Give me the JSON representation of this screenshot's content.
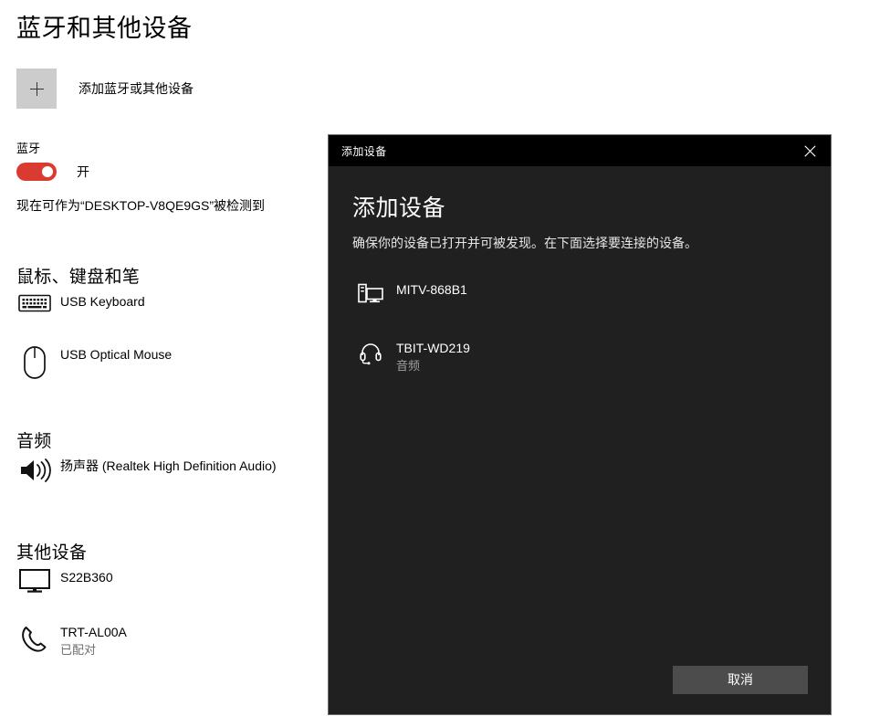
{
  "page": {
    "title": "蓝牙和其他设备",
    "add_device": {
      "icon": "plus-icon",
      "label": "添加蓝牙或其他设备"
    },
    "bluetooth": {
      "label": "蓝牙",
      "toggle_state": "开",
      "toggle_on": true,
      "accent_color": "#d93b30",
      "discoverable_note": "现在可作为“DESKTOP-V8QE9GS”被检测到"
    },
    "sections": [
      {
        "title": "鼠标、键盘和笔",
        "devices": [
          {
            "icon": "keyboard-icon",
            "name": "USB Keyboard",
            "sub": ""
          },
          {
            "icon": "mouse-icon",
            "name": "USB Optical Mouse",
            "sub": ""
          }
        ]
      },
      {
        "title": "音频",
        "devices": [
          {
            "icon": "speaker-icon",
            "name": "扬声器 (Realtek High Definition Audio)",
            "sub": ""
          }
        ]
      },
      {
        "title": "其他设备",
        "devices": [
          {
            "icon": "monitor-icon",
            "name": "S22B360",
            "sub": ""
          },
          {
            "icon": "phone-icon",
            "name": "TRT-AL00A",
            "sub": "已配对"
          }
        ]
      }
    ]
  },
  "dialog": {
    "titlebar": {
      "text": "添加设备",
      "close_icon": "close-icon",
      "background": "#000000"
    },
    "heading": "添加设备",
    "subtitle": "确保你的设备已打开并可被发现。在下面选择要连接的设备。",
    "background": "#202020",
    "devices": [
      {
        "icon": "desktop-pc-icon",
        "name": "MITV-868B1",
        "sub": ""
      },
      {
        "icon": "headset-icon",
        "name": "TBIT-WD219",
        "sub": "音频"
      }
    ],
    "cancel_button": {
      "label": "取消",
      "background": "#4c4c4c"
    }
  }
}
